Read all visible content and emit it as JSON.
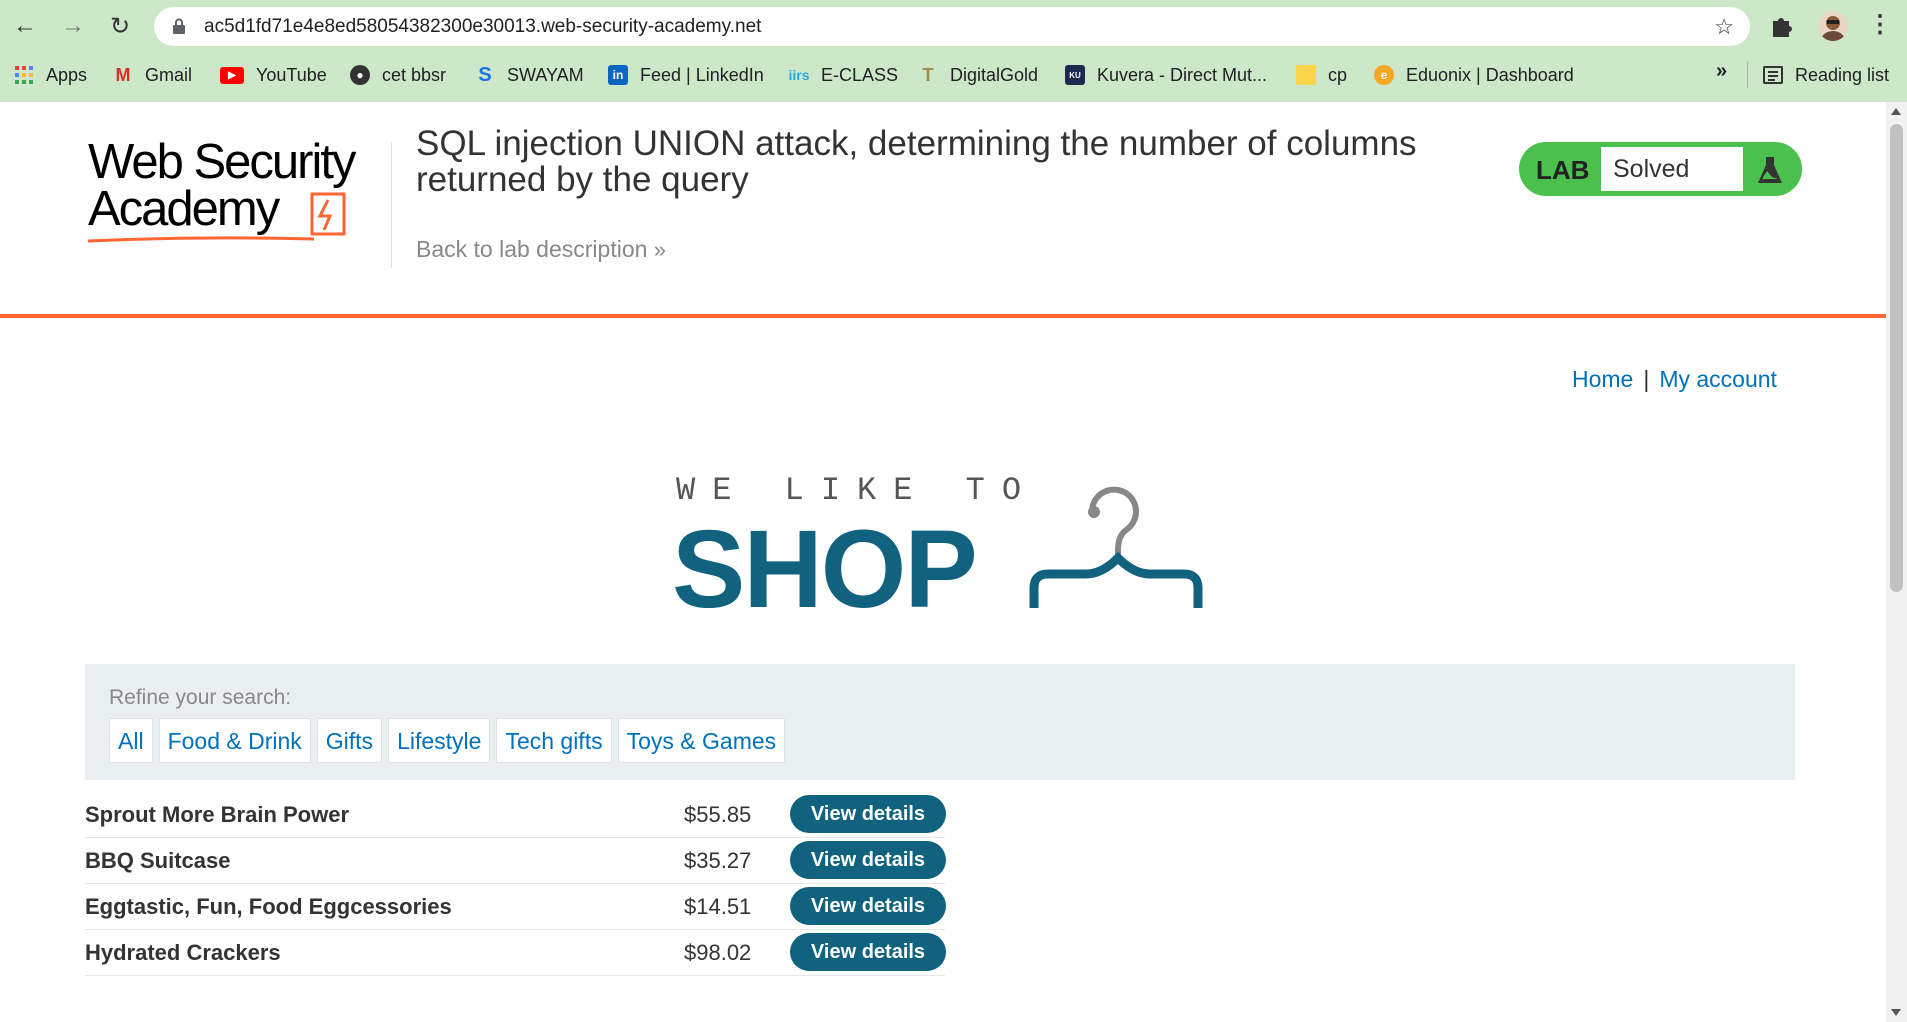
{
  "browser": {
    "url": "ac5d1fd71e4e8ed58054382300e30013.web-security-academy.net",
    "bookmarks": [
      {
        "label": "Apps",
        "icon": "apps-grid-icon"
      },
      {
        "label": "Gmail",
        "icon": "gmail-icon"
      },
      {
        "label": "YouTube",
        "icon": "youtube-icon"
      },
      {
        "label": "cet bbsr",
        "icon": "globe-icon"
      },
      {
        "label": "SWAYAM",
        "icon": "swayam-icon"
      },
      {
        "label": "Feed | LinkedIn",
        "icon": "linkedin-icon"
      },
      {
        "label": "E-CLASS",
        "icon": "eclass-icon"
      },
      {
        "label": "DigitalGold",
        "icon": "digitalgold-icon"
      },
      {
        "label": "Kuvera - Direct Mut...",
        "icon": "kuvera-icon"
      },
      {
        "label": "cp",
        "icon": "folder-icon"
      },
      {
        "label": "Eduonix | Dashboard",
        "icon": "eduonix-icon"
      }
    ],
    "overflow": "»",
    "reading_list": "Reading list"
  },
  "lab": {
    "logo_line1": "Web Security",
    "logo_line2": "Academy",
    "title": "SQL injection UNION attack, determining the number of columns returned by the query",
    "back_link": "Back to lab description",
    "badge_label": "LAB",
    "status": "Solved"
  },
  "nav": {
    "home": "Home",
    "separator": "|",
    "my_account": "My account"
  },
  "shop_logo": {
    "small": "WE LIKE TO",
    "big": "SHOP"
  },
  "search": {
    "label": "Refine your search:",
    "filters": [
      "All",
      "Food & Drink",
      "Gifts",
      "Lifestyle",
      "Tech gifts",
      "Toys & Games"
    ]
  },
  "products": [
    {
      "name": "Sprout More Brain Power",
      "price": "$55.85",
      "action": "View details"
    },
    {
      "name": "BBQ Suitcase",
      "price": "$35.27",
      "action": "View details"
    },
    {
      "name": "Eggtastic, Fun, Food Eggcessories",
      "price": "$14.51",
      "action": "View details"
    },
    {
      "name": "Hydrated Crackers",
      "price": "$98.02",
      "action": "View details"
    }
  ],
  "colors": {
    "chrome_bg": "#cde8c9",
    "accent_orange": "#ff6633",
    "link_blue": "#0071bc",
    "shop_teal": "#10627e",
    "lab_green": "#4cc04c"
  }
}
